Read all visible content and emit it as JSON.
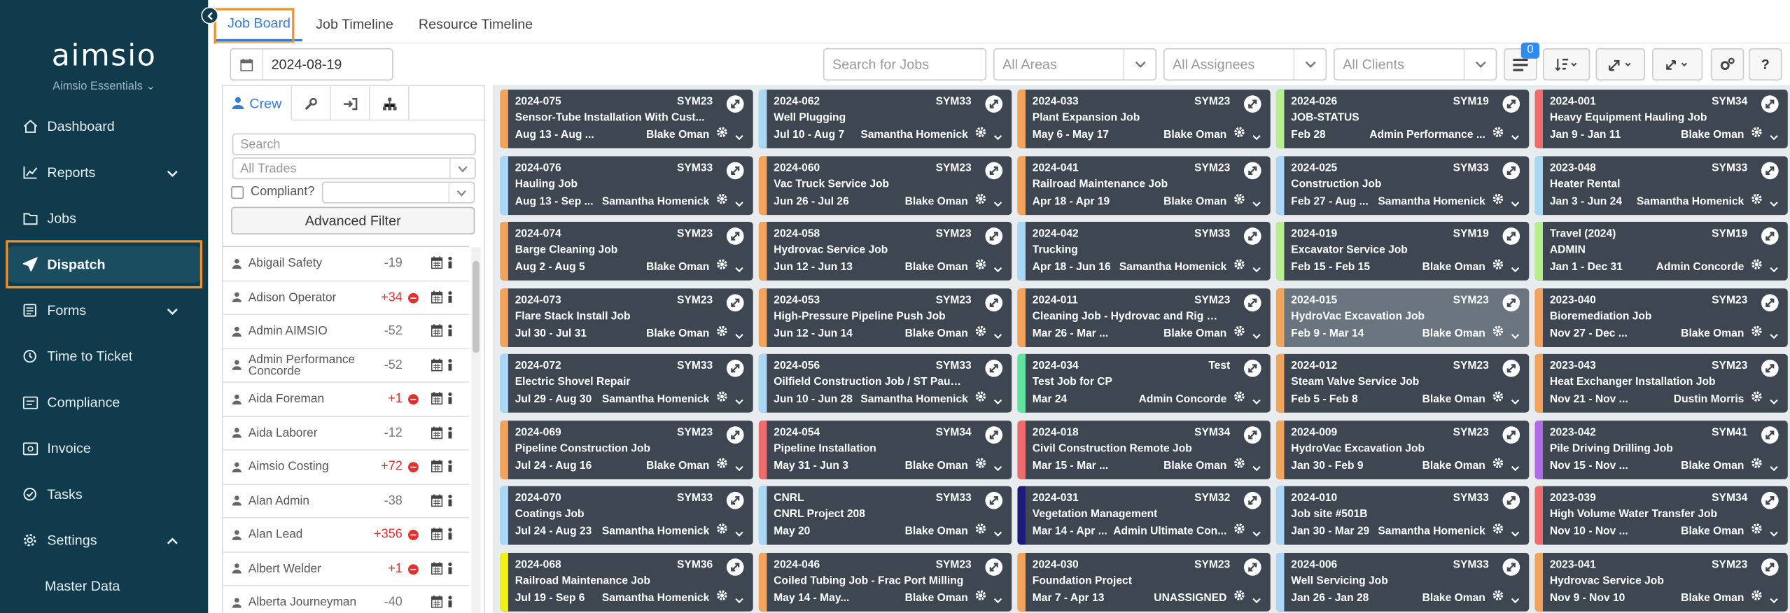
{
  "brand": {
    "logo": "aimsio",
    "sub": "Aimsio Essentials"
  },
  "nav": [
    {
      "label": "Dashboard",
      "icon": "home-icon"
    },
    {
      "label": "Reports",
      "icon": "chart-icon",
      "chev": "down"
    },
    {
      "label": "Jobs",
      "icon": "folder-icon"
    },
    {
      "label": "Dispatch",
      "icon": "paper-plane-icon",
      "active": true
    },
    {
      "label": "Forms",
      "icon": "form-icon",
      "chev": "down"
    },
    {
      "label": "Time to Ticket",
      "icon": "clock-icon"
    },
    {
      "label": "Compliance",
      "icon": "compliance-icon"
    },
    {
      "label": "Invoice",
      "icon": "invoice-icon"
    },
    {
      "label": "Tasks",
      "icon": "check-circle-icon"
    },
    {
      "label": "Settings",
      "icon": "gear-icon",
      "chev": "up"
    }
  ],
  "settings_sub": [
    "Master Data"
  ],
  "tabs": [
    "Job Board",
    "Job Timeline",
    "Resource Timeline"
  ],
  "toolbar": {
    "date": "2024-08-19",
    "search_placeholder": "Search for Jobs",
    "areas": "All Areas",
    "assignees": "All Assignees",
    "clients": "All Clients",
    "badge": "0"
  },
  "panel": {
    "crew_tab": "Crew",
    "search_placeholder": "Search",
    "trades": "All Trades",
    "compliant": "Compliant?",
    "advanced": "Advanced Filter"
  },
  "crew": [
    {
      "name": "Abigail Safety",
      "value": "-19",
      "stop": false
    },
    {
      "name": "Adison Operator",
      "value": "+34",
      "stop": true
    },
    {
      "name": "Admin AIMSIO",
      "value": "-52",
      "stop": false
    },
    {
      "name": "Admin Performance Concorde",
      "value": "-52",
      "stop": false
    },
    {
      "name": "Aida Foreman",
      "value": "+1",
      "stop": true
    },
    {
      "name": "Aida Laborer",
      "value": "-12",
      "stop": false
    },
    {
      "name": "Aimsio Costing",
      "value": "+72",
      "stop": true
    },
    {
      "name": "Alan Admin",
      "value": "-38",
      "stop": false
    },
    {
      "name": "Alan Lead",
      "value": "+356",
      "stop": true
    },
    {
      "name": "Albert Welder",
      "value": "+1",
      "stop": true
    },
    {
      "name": "Alberta Journeyman",
      "value": "-40",
      "stop": false
    }
  ],
  "colors": {
    "orange": "#f4a35a",
    "blue": "#a9d7f5",
    "green": "#b6ef8c",
    "red": "#f06b6b",
    "mint": "#5fe3a1",
    "purple": "#b16be6",
    "navy": "#1d1b7a",
    "yellow": "#f2f218"
  },
  "jobs": [
    [
      {
        "id": "2024-075",
        "code": "SYM23",
        "title": "Sensor-Tube Installation With Cust...",
        "dates": "Aug 13 - Aug ...",
        "assignee": "Blake Oman",
        "color": "orange"
      },
      {
        "id": "2024-076",
        "code": "SYM33",
        "title": "Hauling Job",
        "dates": "Aug 13 - Sep ...",
        "assignee": "Samantha Homenick",
        "color": "blue"
      },
      {
        "id": "2024-074",
        "code": "SYM23",
        "title": "Barge Cleaning Job",
        "dates": "Aug 2 - Aug 5",
        "assignee": "Blake Oman",
        "color": "orange"
      },
      {
        "id": "2024-073",
        "code": "SYM23",
        "title": "Flare Stack Install Job",
        "dates": "Jul 30 - Jul 31",
        "assignee": "Blake Oman",
        "color": "orange"
      },
      {
        "id": "2024-072",
        "code": "SYM33",
        "title": "Electric Shovel Repair",
        "dates": "Jul 29 - Aug 30",
        "assignee": "Samantha Homenick",
        "color": "blue"
      },
      {
        "id": "2024-069",
        "code": "SYM23",
        "title": "Pipeline Construction Job",
        "dates": "Jul 24 - Aug 16",
        "assignee": "Blake Oman",
        "color": "orange"
      },
      {
        "id": "2024-070",
        "code": "SYM33",
        "title": "Coatings Job",
        "dates": "Jul 24 - Aug 23",
        "assignee": "Samantha Homenick",
        "color": "blue"
      },
      {
        "id": "2024-068",
        "code": "SYM36",
        "title": "Railroad Maintenance Job",
        "dates": "Jul 19 - Sep 6",
        "assignee": "Samantha Homenick",
        "color": "yellow"
      }
    ],
    [
      {
        "id": "2024-062",
        "code": "SYM33",
        "title": "Well Plugging",
        "dates": "Jul 10 - Aug 7",
        "assignee": "Samantha Homenick",
        "color": "blue"
      },
      {
        "id": "2024-060",
        "code": "SYM23",
        "title": "Vac Truck Service Job",
        "dates": "Jun 26 - Jul 26",
        "assignee": "Blake Oman",
        "color": "orange"
      },
      {
        "id": "2024-058",
        "code": "SYM23",
        "title": "Hydrovac Service Job",
        "dates": "Jun 12 - Jun 13",
        "assignee": "Blake Oman",
        "color": "orange"
      },
      {
        "id": "2024-053",
        "code": "SYM23",
        "title": "High-Pressure Pipeline Push Job",
        "dates": "Jun 12 - Jun 14",
        "assignee": "Blake Oman",
        "color": "orange"
      },
      {
        "id": "2024-056",
        "code": "SYM33",
        "title": "Oilfield Construction Job / ST Paul B...",
        "dates": "Jun 10 - Jun 28",
        "assignee": "Samantha Homenick",
        "color": "blue"
      },
      {
        "id": "2024-054",
        "code": "SYM34",
        "title": "Pipeline Installation",
        "dates": "May 31 - Jun 3",
        "assignee": "Blake Oman",
        "color": "red"
      },
      {
        "id": "CNRL",
        "code": "SYM33",
        "title": "CNRL Project 208",
        "dates": "May 20",
        "assignee": "Blake Oman",
        "color": "blue"
      },
      {
        "id": "2024-046",
        "code": "SYM23",
        "title": "Coiled Tubing Job - Frac Port Milling",
        "dates": "May 14 - May...",
        "assignee": "Blake Oman",
        "color": "orange"
      }
    ],
    [
      {
        "id": "2024-033",
        "code": "SYM23",
        "title": "Plant Expansion Job",
        "dates": "May 6 - May 17",
        "assignee": "Blake Oman",
        "color": "orange"
      },
      {
        "id": "2024-041",
        "code": "SYM23",
        "title": "Railroad Maintenance Job",
        "dates": "Apr 18 - Apr 19",
        "assignee": "Blake Oman",
        "color": "orange"
      },
      {
        "id": "2024-042",
        "code": "SYM33",
        "title": "Trucking",
        "dates": "Apr 18 - Jun 16",
        "assignee": "Samantha Homenick",
        "color": "blue"
      },
      {
        "id": "2024-011",
        "code": "SYM23",
        "title": "Cleaning Job - Hydrovac and Rig Wa...",
        "dates": "Mar 26 - Mar ...",
        "assignee": "Blake Oman",
        "color": "orange"
      },
      {
        "id": "2024-034",
        "code": "Test",
        "title": "Test Job for CP",
        "dates": "Mar 24",
        "assignee": "Admin Concorde",
        "color": "mint"
      },
      {
        "id": "2024-018",
        "code": "SYM34",
        "title": "Civil Construction Remote Job",
        "dates": "Mar 15 - Mar ...",
        "assignee": "Blake Oman",
        "color": "red"
      },
      {
        "id": "2024-031",
        "code": "SYM32",
        "title": "Vegetation Management",
        "dates": "Mar 14 - Apr ...",
        "assignee": "Admin Ultimate Con...",
        "color": "navy"
      },
      {
        "id": "2024-030",
        "code": "SYM23",
        "title": "Foundation Project",
        "dates": "Mar 7 - Apr 13",
        "assignee": "UNASSIGNED",
        "color": "orange"
      }
    ],
    [
      {
        "id": "2024-026",
        "code": "SYM19",
        "title": "JOB-STATUS",
        "dates": "Feb 28",
        "assignee": "Admin Performance ...",
        "color": "green"
      },
      {
        "id": "2024-025",
        "code": "SYM33",
        "title": "Construction Job",
        "dates": "Feb 27 - Aug ...",
        "assignee": "Samantha Homenick",
        "color": "blue"
      },
      {
        "id": "2024-019",
        "code": "SYM19",
        "title": "Excavator Service Job",
        "dates": "Feb 15 - Feb 15",
        "assignee": "Blake Oman",
        "color": "green"
      },
      {
        "id": "2024-015",
        "code": "SYM23",
        "title": "HydroVac Excavation Job",
        "dates": "Feb 9 - Mar 14",
        "assignee": "Blake Oman",
        "color": "orange",
        "hl": true
      },
      {
        "id": "2024-012",
        "code": "SYM23",
        "title": "Steam Valve Service Job",
        "dates": "Feb 5 - Feb 8",
        "assignee": "Blake Oman",
        "color": "orange"
      },
      {
        "id": "2024-009",
        "code": "SYM23",
        "title": "HydroVac Excavation Job",
        "dates": "Jan 30 - Feb 9",
        "assignee": "Blake Oman",
        "color": "orange"
      },
      {
        "id": "2024-010",
        "code": "SYM33",
        "title": "Job site #501B",
        "dates": "Jan 30 - Mar 29",
        "assignee": "Samantha Homenick",
        "color": "blue"
      },
      {
        "id": "2024-006",
        "code": "SYM33",
        "title": "Well Servicing Job",
        "dates": "Jan 26 - Jan 28",
        "assignee": "Blake Oman",
        "color": "blue"
      }
    ],
    [
      {
        "id": "2024-001",
        "code": "SYM34",
        "title": "Heavy Equipment Hauling Job",
        "dates": "Jan 9 - Jan 11",
        "assignee": "Blake Oman",
        "color": "red"
      },
      {
        "id": "2023-048",
        "code": "SYM33",
        "title": "Heater Rental",
        "dates": "Jan 3 - Jun 24",
        "assignee": "Samantha Homenick",
        "color": "blue"
      },
      {
        "id": "Travel (2024)",
        "code": "SYM19",
        "title": "ADMIN",
        "dates": "Jan 1 - Dec 31",
        "assignee": "Admin Concorde",
        "color": "green"
      },
      {
        "id": "2023-040",
        "code": "SYM23",
        "title": "Bioremediation Job",
        "dates": "Nov 27 - Dec ...",
        "assignee": "Blake Oman",
        "color": "orange"
      },
      {
        "id": "2023-043",
        "code": "SYM23",
        "title": "Heat Exchanger Installation Job",
        "dates": "Nov 21 - Nov ...",
        "assignee": "Dustin Morris",
        "color": "orange"
      },
      {
        "id": "2023-042",
        "code": "SYM41",
        "title": "Pile Driving Drilling Job",
        "dates": "Nov 15 - Nov ...",
        "assignee": "Blake Oman",
        "color": "purple"
      },
      {
        "id": "2023-039",
        "code": "SYM34",
        "title": "High Volume Water Transfer Job",
        "dates": "Nov 10 - Nov ...",
        "assignee": "Blake Oman",
        "color": "red"
      },
      {
        "id": "2023-041",
        "code": "SYM23",
        "title": "Hydrovac Service Job",
        "dates": "Nov 9 - Nov 10",
        "assignee": "Blake Oman",
        "color": "orange"
      }
    ]
  ]
}
